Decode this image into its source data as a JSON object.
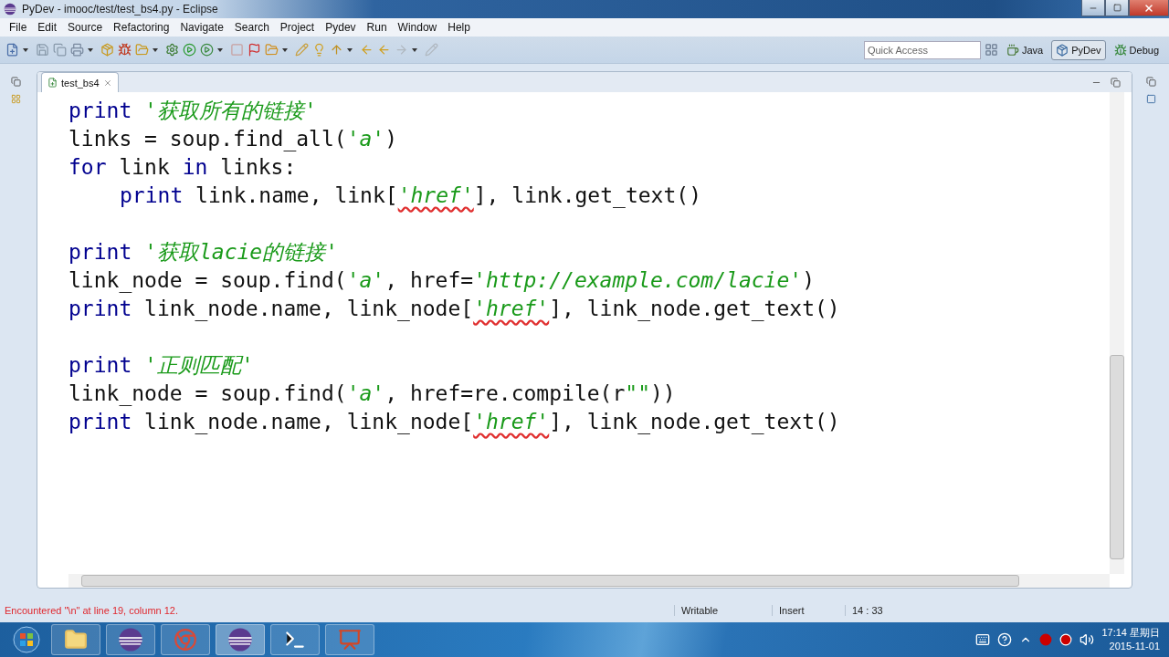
{
  "window": {
    "title": "PyDev - imooc/test/test_bs4.py - Eclipse"
  },
  "menu": [
    "File",
    "Edit",
    "Source",
    "Refactoring",
    "Navigate",
    "Search",
    "Project",
    "Pydev",
    "Run",
    "Window",
    "Help"
  ],
  "quick_access": {
    "placeholder": "Quick Access"
  },
  "perspectives": [
    {
      "label": "Java",
      "selected": false
    },
    {
      "label": "PyDev",
      "selected": true
    },
    {
      "label": "Debug",
      "selected": false
    }
  ],
  "editor": {
    "tabs": [
      {
        "label": "test_bs4",
        "selected": true
      }
    ],
    "lines": [
      {
        "kind": "code",
        "tokens": [
          {
            "t": "print",
            "kind": "keyword"
          },
          {
            "t": " '获取所有的链接'",
            "kind": "string"
          }
        ]
      },
      {
        "kind": "code",
        "tokens": [
          {
            "t": "links = soup.find_all(",
            "kind": "plain"
          },
          {
            "t": "'a'",
            "kind": "string"
          },
          {
            "t": ")",
            "kind": "plain"
          }
        ]
      },
      {
        "kind": "code",
        "tokens": [
          {
            "t": "for",
            "kind": "keyword"
          },
          {
            "t": " link ",
            "kind": "plain"
          },
          {
            "t": "in",
            "kind": "keyword"
          },
          {
            "t": " links:",
            "kind": "plain"
          }
        ]
      },
      {
        "kind": "indented",
        "tokens": [
          {
            "t": "print",
            "kind": "keyword"
          },
          {
            "t": " link.name, link[",
            "kind": "plain"
          },
          {
            "t": "'href'",
            "kind": "flagged_string"
          },
          {
            "t": "], link.get_text()",
            "kind": "plain"
          }
        ]
      },
      {
        "kind": "blank"
      },
      {
        "kind": "code",
        "tokens": [
          {
            "t": "print",
            "kind": "keyword"
          },
          {
            "t": " '获取lacie的链接'",
            "kind": "string"
          }
        ]
      },
      {
        "kind": "code",
        "tokens": [
          {
            "t": "link_node = soup.find(",
            "kind": "plain"
          },
          {
            "t": "'a'",
            "kind": "string"
          },
          {
            "t": ", href=",
            "kind": "plain"
          },
          {
            "t": "'http://example.com/lacie'",
            "kind": "string"
          },
          {
            "t": ")",
            "kind": "plain"
          }
        ]
      },
      {
        "kind": "code",
        "tokens": [
          {
            "t": "print",
            "kind": "keyword"
          },
          {
            "t": " link_node.name, link_node[",
            "kind": "plain"
          },
          {
            "t": "'href'",
            "kind": "flagged_string"
          },
          {
            "t": "], link_node.get_text()",
            "kind": "plain"
          }
        ]
      },
      {
        "kind": "blank"
      },
      {
        "kind": "code",
        "tokens": [
          {
            "t": "print",
            "kind": "keyword"
          },
          {
            "t": " '正则匹配'",
            "kind": "string"
          }
        ]
      },
      {
        "kind": "code",
        "tokens": [
          {
            "t": "link_node = soup.find(",
            "kind": "plain"
          },
          {
            "t": "'a'",
            "kind": "string"
          },
          {
            "t": ", href=re.compile(r",
            "kind": "plain"
          },
          {
            "t": "\"\"",
            "kind": "string"
          },
          {
            "t": "))",
            "kind": "plain"
          }
        ]
      },
      {
        "kind": "code",
        "tokens": [
          {
            "t": "print",
            "kind": "keyword"
          },
          {
            "t": " link_node.name, link_node[",
            "kind": "plain"
          },
          {
            "t": "'href'",
            "kind": "flagged_string"
          },
          {
            "t": "], link_node.get_text()",
            "kind": "plain"
          }
        ]
      }
    ]
  },
  "status_bar": {
    "message": "Encountered \"\\n\" at line 19, column 12.",
    "fields": [
      "Writable",
      "Insert",
      "14 : 33"
    ]
  },
  "taskbar": {
    "clock_time": "17:14 星期日",
    "clock_date": "2015-11-01"
  }
}
